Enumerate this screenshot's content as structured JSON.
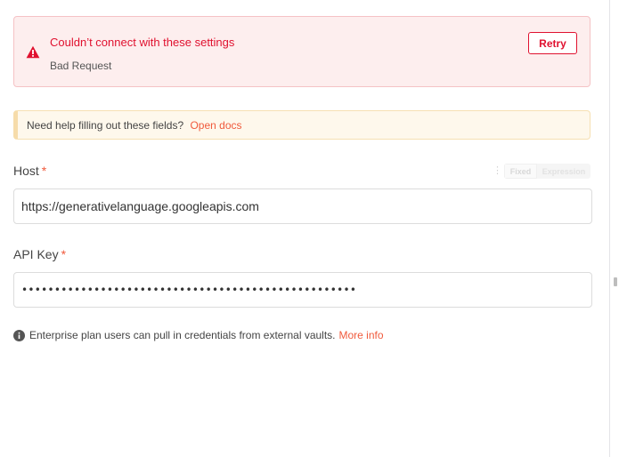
{
  "error": {
    "title": "Couldn’t connect with these settings",
    "message": "Bad Request",
    "retry_label": "Retry"
  },
  "help": {
    "text": "Need help filling out these fields?",
    "link_label": "Open docs"
  },
  "fields": {
    "host": {
      "label": "Host",
      "required_marker": "*",
      "value": "https://generativelanguage.googleapis.com"
    },
    "api_key": {
      "label": "API Key",
      "required_marker": "*",
      "value": "•••••••••••••••••••••••••••••••••••••••••••••••••••"
    }
  },
  "mode_toggle": {
    "fixed_label": "Fixed",
    "expression_label": "Expression"
  },
  "info": {
    "text": "Enterprise plan users can pull in credentials from external vaults.",
    "link_label": "More info"
  },
  "colors": {
    "error_red": "#e0112f",
    "accent_orange": "#f05a3c",
    "error_bg": "#fdeeee",
    "help_bg": "#fef8ec"
  },
  "icons": {
    "error": "warning-triangle-icon",
    "info": "info-circle-icon",
    "menu": "kebab-menu-icon"
  }
}
